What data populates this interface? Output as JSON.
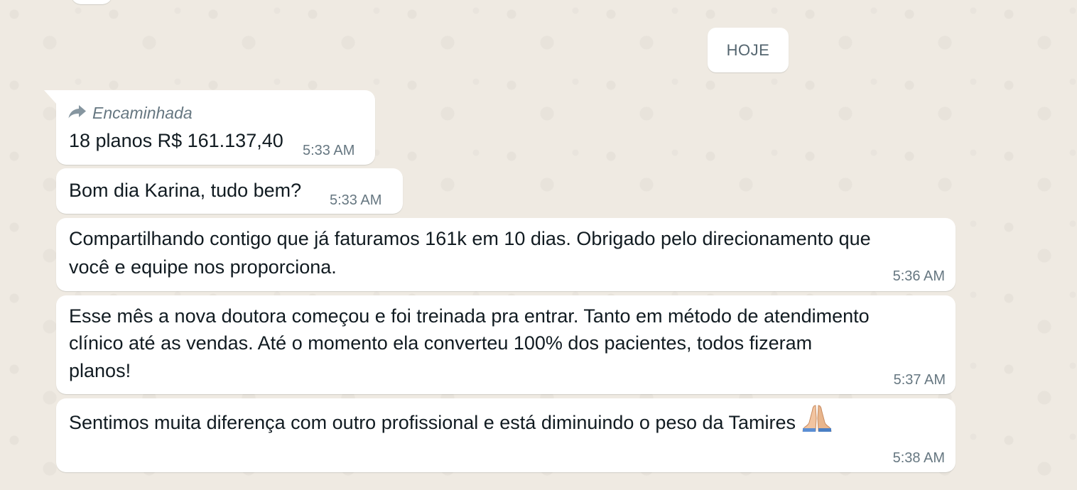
{
  "date_divider": "HOJE",
  "messages": [
    {
      "forwarded_label": "Encaminhada",
      "lines": [
        "18 planos R$ 161.137,40"
      ],
      "time": "5:33 AM"
    },
    {
      "lines": [
        "Bom dia Karina, tudo bem?"
      ],
      "time": "5:33 AM"
    },
    {
      "lines": [
        "Compartilhando contigo que já faturamos 161k em 10 dias.  Obrigado pelo direcionamento que",
        "você e equipe nos proporciona."
      ],
      "time": "5:36 AM"
    },
    {
      "lines": [
        "Esse mês a nova doutora começou e foi treinada pra entrar. Tanto em método de atendimento",
        "clínico até as vendas. Até o momento ela converteu 100% dos pacientes, todos fizeram",
        "planos!"
      ],
      "time": "5:37 AM"
    },
    {
      "lines": [
        "Sentimos muita diferença com outro profissional e está diminuindo o peso da Tamires"
      ],
      "emoji": "folded-hands-icon",
      "time": "5:38 AM"
    }
  ],
  "colors": {
    "background": "#efeae2",
    "bubble": "#ffffff",
    "text": "#111b21",
    "meta": "#667781"
  }
}
